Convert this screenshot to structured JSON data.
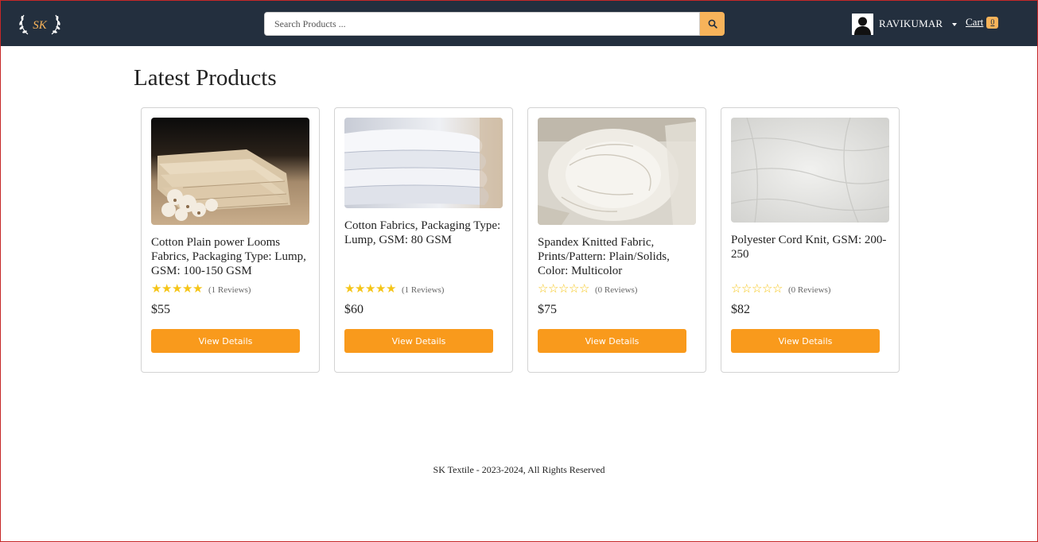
{
  "header": {
    "logo_text": "SK",
    "search": {
      "placeholder": "Search Products ...",
      "value": ""
    },
    "user": {
      "name": "RAVIKUMAR"
    },
    "cart": {
      "label": "Cart",
      "count": "0"
    }
  },
  "main": {
    "title": "Latest Products",
    "products": [
      {
        "name": "Cotton Plain power Looms Fabrics, Packaging Type: Lump, GSM: 100-150 GSM",
        "rating": 5,
        "reviews": "(1 Reviews)",
        "price": "$55",
        "button": "View Details"
      },
      {
        "name": "Cotton Fabrics, Packaging Type: Lump, GSM: 80 GSM",
        "rating": 5,
        "reviews": "(1 Reviews)",
        "price": "$60",
        "button": "View Details"
      },
      {
        "name": "Spandex Knitted Fabric, Prints/Pattern: Plain/Solids, Color: Multicolor",
        "rating": 0,
        "reviews": "(0 Reviews)",
        "price": "$75",
        "button": "View Details"
      },
      {
        "name": "Polyester Cord Knit, GSM: 200-250",
        "rating": 0,
        "reviews": "(0 Reviews)",
        "price": "$82",
        "button": "View Details"
      }
    ]
  },
  "footer": {
    "text": "SK Textile - 2023-2024, All Rights Reserved"
  },
  "colors": {
    "navbar": "#232f3e",
    "accent": "#f99a1c",
    "search_button": "#f7b35a",
    "star": "#f5c518"
  }
}
